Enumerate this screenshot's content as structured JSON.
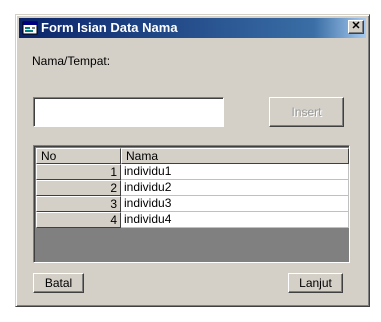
{
  "window": {
    "title": "Form Isian Data Nama",
    "close_glyph": "✕",
    "icon": "form-app-icon"
  },
  "form": {
    "label": "Nama/Tempat:",
    "input_value": "",
    "insert_label": "Insert"
  },
  "grid": {
    "columns": [
      "No",
      "Nama"
    ],
    "rows": [
      {
        "no": "1",
        "nama": "individu1"
      },
      {
        "no": "2",
        "nama": "individu2"
      },
      {
        "no": "3",
        "nama": "individu3"
      },
      {
        "no": "4",
        "nama": "individu4"
      }
    ]
  },
  "buttons": {
    "batal": "Batal",
    "lanjut": "Lanjut"
  }
}
